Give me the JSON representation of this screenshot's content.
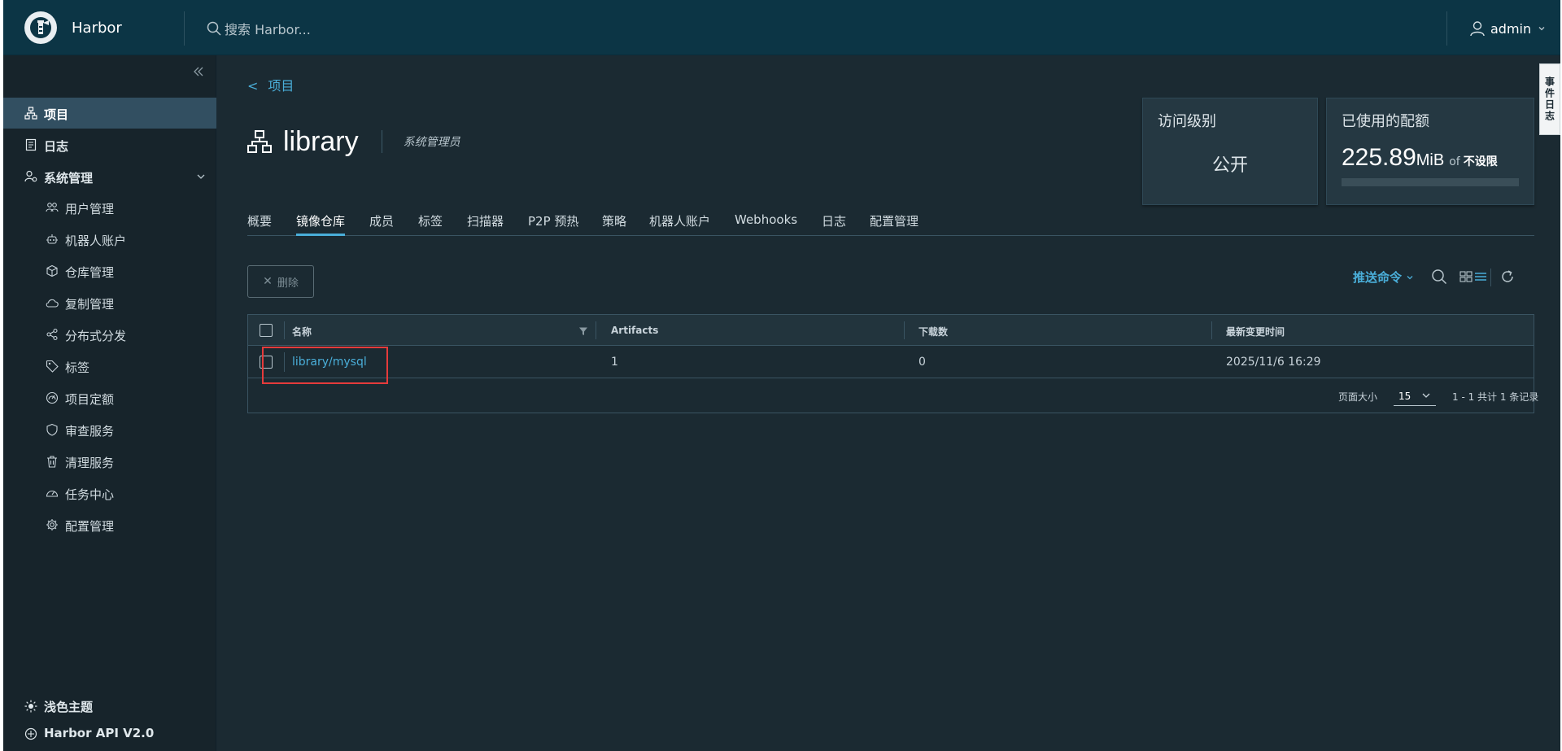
{
  "header": {
    "brand": "Harbor",
    "search_placeholder": "搜索 Harbor...",
    "user": "admin"
  },
  "sidebar": {
    "items": [
      {
        "label": "项目",
        "icon": "project-icon",
        "active": true
      },
      {
        "label": "日志",
        "icon": "log-icon"
      },
      {
        "label": "系统管理",
        "icon": "admin-icon",
        "expanded": true
      }
    ],
    "sub_items": [
      {
        "label": "用户管理",
        "icon": "users-icon"
      },
      {
        "label": "机器人账户",
        "icon": "robot-icon"
      },
      {
        "label": "仓库管理",
        "icon": "cube-icon"
      },
      {
        "label": "复制管理",
        "icon": "cloud-icon"
      },
      {
        "label": "分布式分发",
        "icon": "share-icon"
      },
      {
        "label": "标签",
        "icon": "tag-icon"
      },
      {
        "label": "项目定额",
        "icon": "gauge-icon"
      },
      {
        "label": "审查服务",
        "icon": "shield-icon"
      },
      {
        "label": "清理服务",
        "icon": "trash-icon"
      },
      {
        "label": "任务中心",
        "icon": "dashboard-icon"
      },
      {
        "label": "配置管理",
        "icon": "gear-icon"
      }
    ],
    "footer": {
      "theme": "浅色主题",
      "api": "Harbor API V2.0"
    }
  },
  "breadcrumb": {
    "arrow": "<",
    "label": "项目"
  },
  "project": {
    "name": "library",
    "role": "系统管理员"
  },
  "cards": {
    "access_title": "访问级别",
    "access_value": "公开",
    "quota_title": "已使用的配额",
    "quota_value": "225.89",
    "quota_unit": "MiB",
    "quota_of": "of",
    "quota_limit": "不设限",
    "quota_fraction": 0
  },
  "tabs": [
    {
      "label": "概要"
    },
    {
      "label": "镜像仓库",
      "active": true
    },
    {
      "label": "成员"
    },
    {
      "label": "标签"
    },
    {
      "label": "扫描器"
    },
    {
      "label": "P2P 预热"
    },
    {
      "label": "策略"
    },
    {
      "label": "机器人账户"
    },
    {
      "label": "Webhooks"
    },
    {
      "label": "日志"
    },
    {
      "label": "配置管理"
    }
  ],
  "toolbar": {
    "delete_icon": "✕",
    "delete_label": "删除",
    "push_command": "推送命令"
  },
  "table": {
    "columns": [
      "名称",
      "Artifacts",
      "下载数",
      "最新变更时间"
    ],
    "rows": [
      {
        "name": "library/mysql",
        "artifacts": "1",
        "downloads": "0",
        "updated": "2025/11/6 16:29"
      }
    ],
    "footer": {
      "page_size_label": "页面大小",
      "page_size": "15",
      "summary": "1 - 1 共计 1 条记录"
    }
  },
  "side_tab": "事件日志",
  "colors": {
    "accent": "#4aaed9",
    "header_bg": "#0c3545",
    "content_bg": "#1b2a32",
    "sidebar_bg": "#17242b",
    "active_nav": "#324f61",
    "highlight": "#e53b3b"
  }
}
